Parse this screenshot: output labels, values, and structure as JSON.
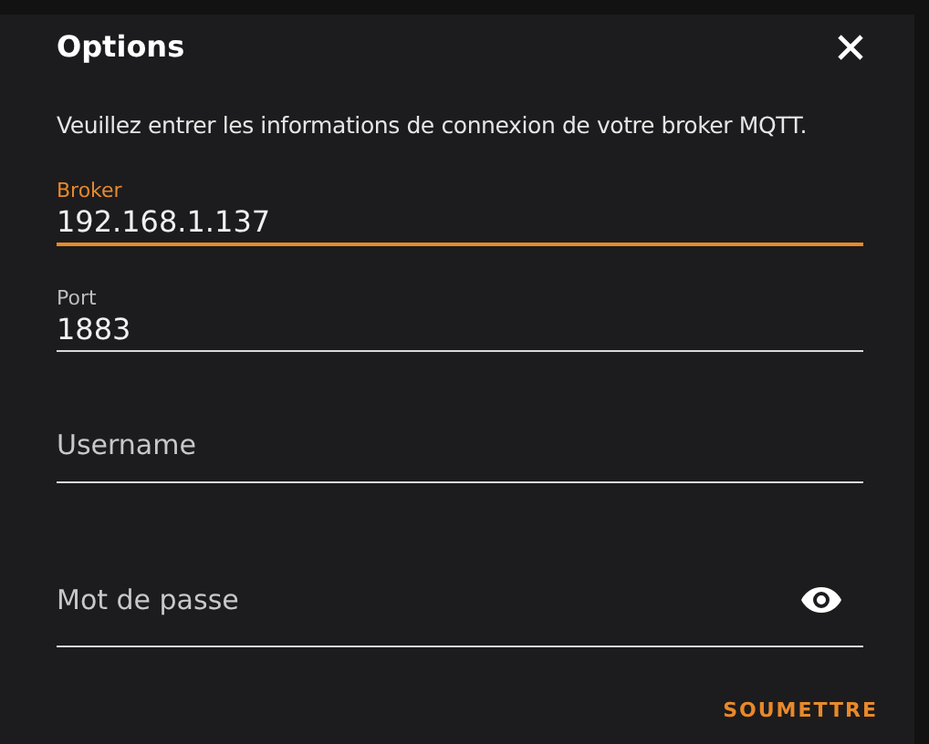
{
  "dialog": {
    "title": "Options",
    "description": "Veuillez entrer les informations de connexion de votre broker MQTT.",
    "fields": [
      {
        "label": "Broker",
        "value": "192.168.1.137",
        "focused": true
      },
      {
        "label": "Port",
        "value": "1883",
        "focused": false
      },
      {
        "placeholder": "Username",
        "focused": false
      },
      {
        "placeholder": "Mot de passe",
        "focused": false,
        "kind": "password"
      }
    ],
    "submit": "SOUMETTRE"
  }
}
